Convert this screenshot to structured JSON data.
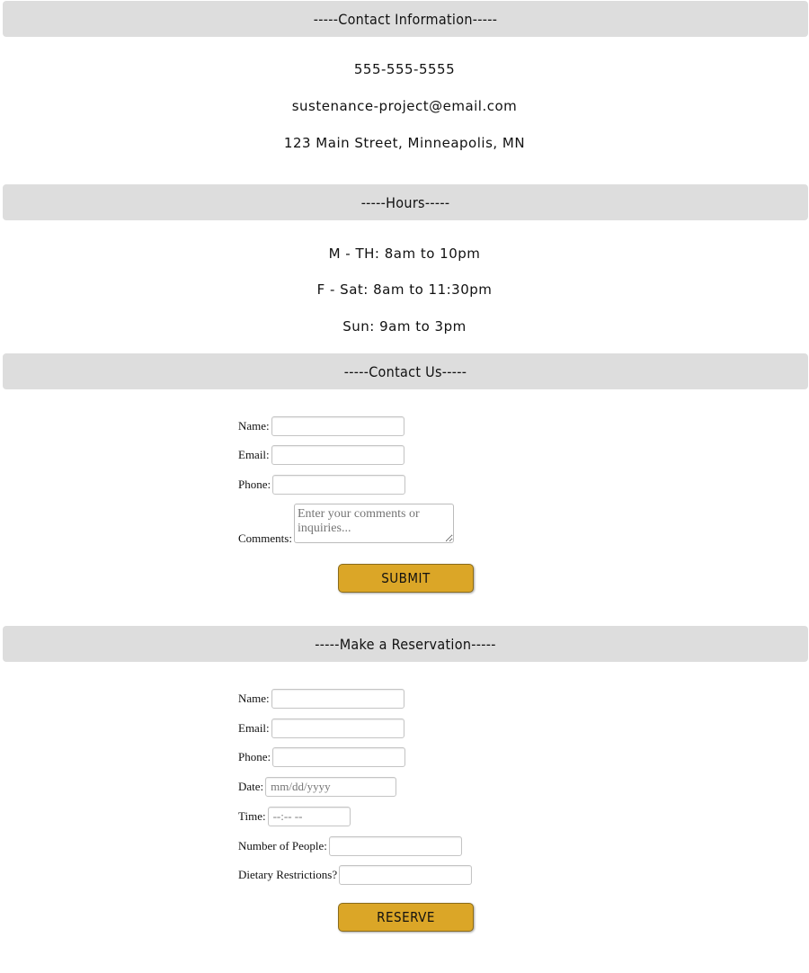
{
  "contact_info": {
    "heading": "-----Contact Information-----",
    "phone": "555-555-5555",
    "email": "sustenance-project@email.com",
    "address": "123 Main Street, Minneapolis, MN"
  },
  "hours": {
    "heading": "-----Hours-----",
    "lines": [
      "M - TH: 8am to 10pm",
      "F - Sat: 8am to 11:30pm",
      "Sun: 9am to 3pm"
    ]
  },
  "contact_form": {
    "heading": "-----Contact Us-----",
    "name_label": "Name:",
    "email_label": "Email:",
    "phone_label": "Phone:",
    "comments_label": "Comments:",
    "comments_placeholder": "Enter your comments or inquiries...",
    "submit_label": "SUBMIT"
  },
  "reservation_form": {
    "heading": "-----Make a Reservation-----",
    "name_label": "Name:",
    "email_label": "Email:",
    "phone_label": "Phone:",
    "date_label": "Date:",
    "date_placeholder": "mm/dd/yyyy",
    "time_label": "Time:",
    "time_placeholder": "--:-- --",
    "people_label": "Number of People:",
    "dietary_label": "Dietary Restrictions?",
    "reserve_label": "RESERVE"
  },
  "colors": {
    "band": "#dddddd",
    "button": "#dba627"
  }
}
